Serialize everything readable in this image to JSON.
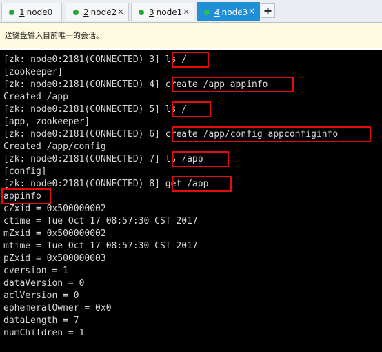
{
  "tabs": [
    {
      "num": "1",
      "label": "node0",
      "active": false
    },
    {
      "num": "2",
      "label": "node2",
      "active": false
    },
    {
      "num": "3",
      "label": "node1",
      "active": false
    },
    {
      "num": "4",
      "label": "node3",
      "active": true
    }
  ],
  "add_tab_label": "+",
  "close_glyph": "×",
  "info_bar": {
    "text": "送键盘输入目前唯一的会话。"
  },
  "terminal": {
    "lines": [
      "[zk: node0:2181(CONNECTED) 3] ls /",
      "[zookeeper]",
      "[zk: node0:2181(CONNECTED) 4] create /app appinfo",
      "Created /app",
      "[zk: node0:2181(CONNECTED) 5] ls /",
      "[app, zookeeper]",
      "[zk: node0:2181(CONNECTED) 6] create /app/config appconfiginfo",
      "Created /app/config",
      "[zk: node0:2181(CONNECTED) 7] ls /app",
      "[config]",
      "[zk: node0:2181(CONNECTED) 8] get /app",
      "appinfo",
      "cZxid = 0x500000002",
      "ctime = Tue Oct 17 08:57:30 CST 2017",
      "mZxid = 0x500000002",
      "mtime = Tue Oct 17 08:57:30 CST 2017",
      "pZxid = 0x500000003",
      "cversion = 1",
      "dataVersion = 0",
      "aclVersion = 0",
      "ephemeralOwner = 0x0",
      "dataLength = 7",
      "numChildren = 1"
    ]
  },
  "colors": {
    "highlight_box": "#e30b0b",
    "active_tab": "#1f8fd8",
    "status_dot": "#29a83a",
    "terminal_bg": "#000000",
    "terminal_fg": "#d9d9d9"
  }
}
